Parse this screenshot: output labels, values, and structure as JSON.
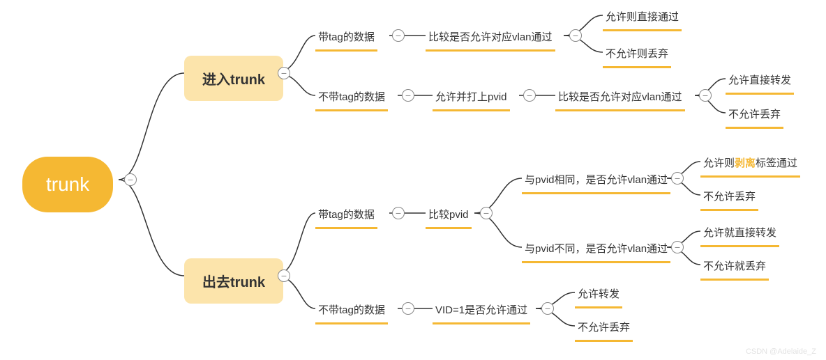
{
  "root": "trunk",
  "branch1": "进入trunk",
  "branch2": "出去trunk",
  "n_in_tag": "带tag的数据",
  "n_in_tag_cmp": "比较是否允许对应vlan通过",
  "n_in_tag_allow": "允许则直接通过",
  "n_in_tag_deny": "不允许则丢弃",
  "n_in_notag": "不带tag的数据",
  "n_in_notag_pvid": "允许并打上pvid",
  "n_in_notag_cmp": "比较是否允许对应vlan通过",
  "n_in_notag_allow": "允许直接转发",
  "n_in_notag_deny": "不允许丢弃",
  "n_out_tag": "带tag的数据",
  "n_out_tag_cmp": "比较pvid",
  "n_out_tag_same": "与pvid相同，是否允许vlan通过",
  "n_out_tag_same_allow_pre": "允许则",
  "n_out_tag_same_allow_hl": "剥离",
  "n_out_tag_same_allow_post": "标签通过",
  "n_out_tag_same_deny": "不允许丢弃",
  "n_out_tag_diff": "与pvid不同，是否允许vlan通过",
  "n_out_tag_diff_allow": "允许就直接转发",
  "n_out_tag_diff_deny": "不允许就丢弃",
  "n_out_notag": "不带tag的数据",
  "n_out_notag_vid": "VID=1是否允许通过",
  "n_out_notag_allow": "允许转发",
  "n_out_notag_deny": "不允许丢弃",
  "watermark": "CSDN @Adelaide_Z",
  "collapse_glyph": "−"
}
